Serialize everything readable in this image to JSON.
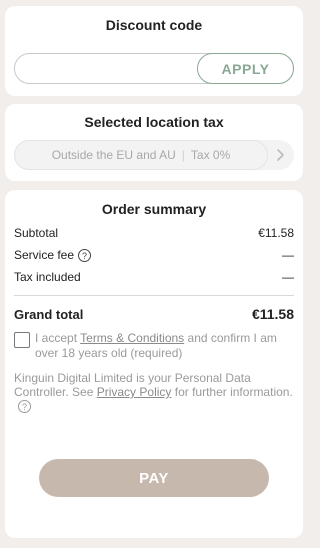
{
  "discount": {
    "title": "Discount code",
    "input_value": "",
    "apply_label": "APPLY"
  },
  "tax": {
    "title": "Selected location tax",
    "location": "Outside the EU and AU",
    "rate_label": "Tax 0%"
  },
  "summary": {
    "title": "Order summary",
    "subtotal_label": "Subtotal",
    "subtotal_value": "€11.58",
    "service_fee_label": "Service fee",
    "service_fee_value": "—",
    "tax_label": "Tax included",
    "tax_value": "—",
    "grand_total_label": "Grand total",
    "grand_total_value": "€11.58"
  },
  "terms": {
    "prefix": "I accept ",
    "link": "Terms & Conditions",
    "suffix": " and confirm I am over 18 years old (required)"
  },
  "notice": {
    "prefix": "Kinguin Digital Limited is your Personal Data Controller. See ",
    "link": "Privacy Policy",
    "suffix": " for further information."
  },
  "pay_label": "PAY",
  "colors": {
    "page_bg": "#f1eeec",
    "accent_green": "#8aa894",
    "pay_button": "#c6b8ad"
  },
  "icons": [
    "help-icon",
    "chevron-right-icon"
  ]
}
